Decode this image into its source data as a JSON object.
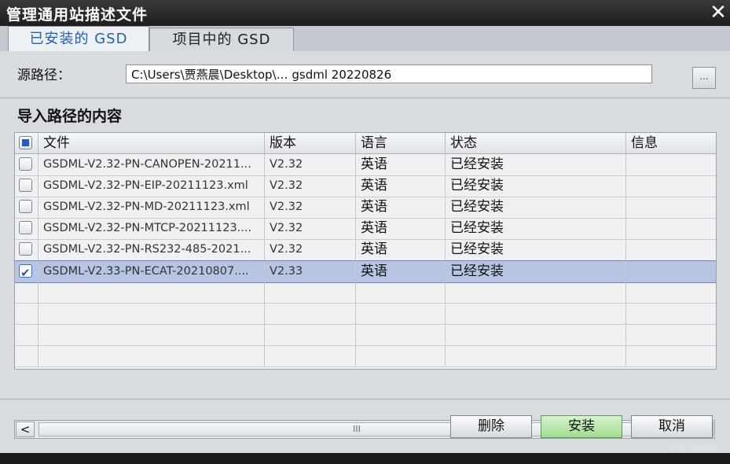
{
  "window": {
    "title": "管理通用站描述文件",
    "close_glyph": "✕"
  },
  "tabs": [
    {
      "label": "已安装的 GSD",
      "active": true
    },
    {
      "label": "项目中的 GSD",
      "active": false
    }
  ],
  "source": {
    "label": "源路径：",
    "path": "C:\\Users\\贾燕晨\\Desktop\\…    gsdml 20220826",
    "browse_label": "..."
  },
  "section_title": "导入路径的内容",
  "table": {
    "columns": [
      "文件",
      "版本",
      "语言",
      "状态",
      "信息"
    ],
    "rows": [
      {
        "file": "GSDML-V2.32-PN-CANOPEN-20211...",
        "version": "V2.32",
        "language": "英语",
        "status": "已经安装",
        "info": "",
        "checked": false,
        "selected": false
      },
      {
        "file": "GSDML-V2.32-PN-EIP-20211123.xml",
        "version": "V2.32",
        "language": "英语",
        "status": "已经安装",
        "info": "",
        "checked": false,
        "selected": false
      },
      {
        "file": "GSDML-V2.32-PN-MD-20211123.xml",
        "version": "V2.32",
        "language": "英语",
        "status": "已经安装",
        "info": "",
        "checked": false,
        "selected": false
      },
      {
        "file": "GSDML-V2.32-PN-MTCP-20211123....",
        "version": "V2.32",
        "language": "英语",
        "status": "已经安装",
        "info": "",
        "checked": false,
        "selected": false
      },
      {
        "file": "GSDML-V2.32-PN-RS232-485-2021...",
        "version": "V2.32",
        "language": "英语",
        "status": "已经安装",
        "info": "",
        "checked": false,
        "selected": false
      },
      {
        "file": "GSDML-V2.33-PN-ECAT-20210807....",
        "version": "V2.33",
        "language": "英语",
        "status": "已经安装",
        "info": "",
        "checked": true,
        "selected": true
      }
    ]
  },
  "scrollbar": {
    "left_glyph": "<",
    "right_glyph": ">",
    "thumb_grip": "III"
  },
  "buttons": {
    "delete": "删除",
    "install": "安装",
    "cancel": "取消"
  },
  "watermark": "CSDN @bjbxkj",
  "colors": {
    "accent": "#1f5fc4",
    "selection": "#b6c5e2",
    "install_green": "#9fdc8f"
  }
}
